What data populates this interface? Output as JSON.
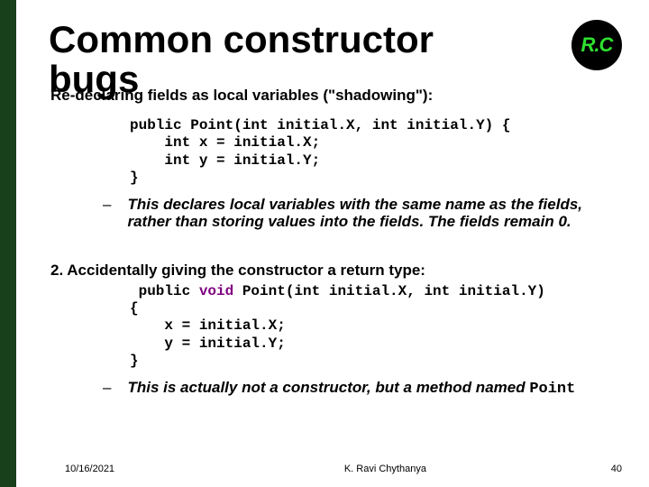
{
  "logo": {
    "text": "R.C"
  },
  "title": {
    "line1": "Common constructor",
    "line2": "bugs"
  },
  "section1": {
    "heading": "Re-declaring fields as local variables  (\"shadowing\"):",
    "code": "public Point(int initial.X, int initial.Y) {\n    int x = initial.X;\n    int y = initial.Y;\n}",
    "bullet": "This declares local variables with the same name as the fields, rather than storing values into the fields.  The fields remain 0."
  },
  "section2": {
    "heading": "2.  Accidentally giving the constructor a return type:",
    "code_pre": " public ",
    "code_kw": "void",
    "code_post": " Point(int initial.X, int initial.Y)\n{\n    x = initial.X;\n    y = initial.Y;\n}",
    "bullet_pre": "This is actually not a constructor, but a method named ",
    "bullet_mono": "Point"
  },
  "footer": {
    "date": "10/16/2021",
    "author": "K. Ravi Chythanya",
    "page": "40"
  }
}
